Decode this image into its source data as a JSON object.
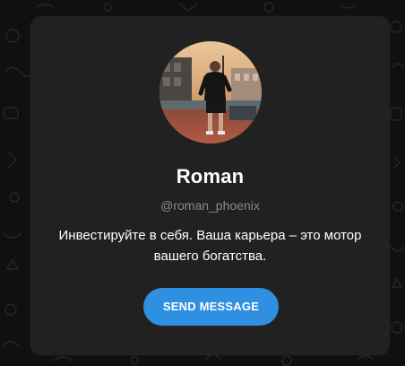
{
  "profile": {
    "name": "Roman",
    "username": "@roman_phoenix",
    "bio": "Инвестируйте в себя. Ваша карьера – это мотор вашего богатства.",
    "send_button_label": "SEND MESSAGE"
  },
  "colors": {
    "card_background": "#212121",
    "page_background": "#101010",
    "accent_button": "#2f8fe0",
    "username_gray": "#8a8a8a",
    "text_white": "#ffffff"
  },
  "icons": {
    "background_pattern": "doodle-pattern"
  }
}
